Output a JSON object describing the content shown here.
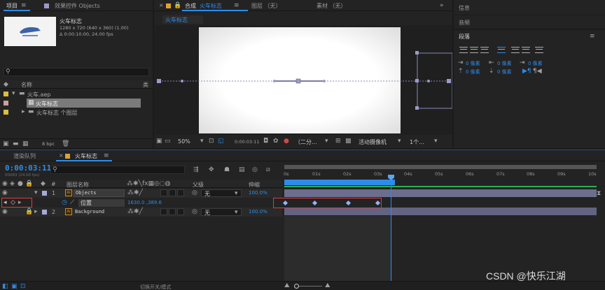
{
  "project": {
    "tab_label": "项目",
    "effects_label": "效果控件 Objects",
    "comp_name": "火车标志",
    "comp_info_line1": "1280 x 720 (640 x 360) (1.00)",
    "comp_info_line2": "Δ 0:00:10:00, 24.00 fps",
    "column_name": "名称",
    "column_extra": "类",
    "items": [
      {
        "label": "火车.aep"
      },
      {
        "label": "火车标志"
      },
      {
        "label": "火车标志 个图层"
      }
    ],
    "bpc": "8 bpc"
  },
  "composition": {
    "close_mark": "×",
    "tab_prefix": "合成",
    "tab_name": "火车标志",
    "tab_layer": "图层 （无）",
    "tab_footage": "素材 （无）",
    "sub_tab": "火车标志",
    "zoom": "50%",
    "timecode": "0:00:03:11",
    "resolution": "（二分...",
    "camera": "活动摄像机",
    "views": "1个..."
  },
  "right_panel": {
    "info_label": "信息",
    "audio_label": "音频",
    "paragraph_label": "段落",
    "indent_values": [
      "0 像素",
      "0 像素",
      "0 像素",
      "0 像素",
      "0 像素"
    ]
  },
  "timeline": {
    "render_queue": "渲染队列",
    "comp_tab": "火车标志",
    "current_time": "0:00:03:11",
    "frame_info": "00083 (24.00 fps)",
    "search_placeholder": "",
    "col_num": "#",
    "col_layer_name": "图层名称",
    "col_parent": "父级",
    "col_stretch": "伸缩",
    "layers": [
      {
        "num": "1",
        "name": "Objects",
        "parent": "无",
        "stretch": "100.0%"
      },
      {
        "num": "2",
        "name": "Background",
        "parent": "无",
        "stretch": "100.0%"
      }
    ],
    "property_label": "位置",
    "property_value": "1630.0 ,389.6",
    "ruler_ticks": [
      "0s",
      "01s",
      "02s",
      "03s",
      "04s",
      "05s",
      "06s",
      "07s",
      "08s",
      "09s",
      "10s"
    ],
    "bottom_label": "切换开关/模式"
  },
  "watermark": "CSDN @快乐江湖"
}
